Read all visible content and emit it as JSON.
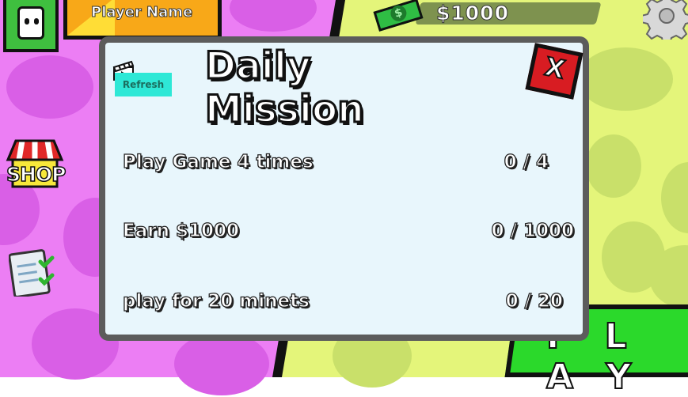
{
  "player": {
    "name": "Player Name"
  },
  "money": {
    "amount": "$1000"
  },
  "sidebar": {
    "shop_label": "SHOP"
  },
  "play_button": {
    "label": "P L A Y"
  },
  "modal": {
    "title": "Daily Mission",
    "close_label": "X",
    "refresh_label": "Refresh",
    "missions": [
      {
        "label": "Play Game 4 times",
        "progress": "0 / 4"
      },
      {
        "label": "Earn $1000",
        "progress": "0 / 1000"
      },
      {
        "label": "play for 20 minets",
        "progress": "0 / 20"
      }
    ]
  },
  "colors": {
    "background_left": "#ec7ef4",
    "background_right": "#e4f57a",
    "modal_bg": "#e8f6fc",
    "close_button": "#d81c22",
    "play_button": "#2bd92b",
    "refresh_button": "#2ee8d6"
  },
  "icons": [
    "avatar-icon",
    "cash-icon",
    "gear-icon",
    "shop-icon",
    "mission-list-icon",
    "clapperboard-icon",
    "close-icon"
  ]
}
